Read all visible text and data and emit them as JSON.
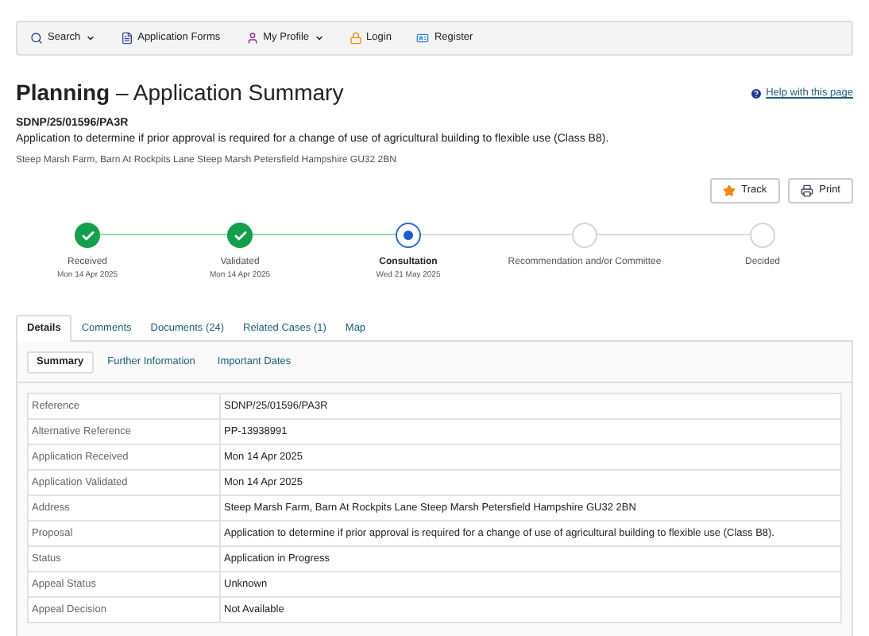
{
  "nav": [
    {
      "label": "Search",
      "dropdown": true
    },
    {
      "label": "Application Forms",
      "dropdown": false
    },
    {
      "label": "My Profile",
      "dropdown": true
    },
    {
      "label": "Login",
      "dropdown": false
    },
    {
      "label": "Register",
      "dropdown": false
    }
  ],
  "title": {
    "bold": "Planning",
    "rest": "– Application Summary"
  },
  "help_link": "Help with this page",
  "reference": "SDNP/25/01596/PA3R",
  "description": "Application to determine if prior approval is required for a change of use of agricultural building to flexible use (Class B8).",
  "address": "Steep Marsh Farm, Barn At Rockpits Lane Steep Marsh Petersfield Hampshire GU32 2BN",
  "actions": [
    {
      "label": "Track"
    },
    {
      "label": "Print"
    }
  ],
  "steps": [
    {
      "label": "Received",
      "date": "Mon 14 Apr 2025",
      "kind": "done"
    },
    {
      "label": "Validated",
      "date": "Mon 14 Apr 2025",
      "kind": "done"
    },
    {
      "label": "Consultation",
      "date": "Wed 21 May 2025",
      "kind": "current"
    },
    {
      "label": "Recommendation and/or Committee",
      "kind": "pending"
    },
    {
      "label": "Decided",
      "kind": "pending"
    }
  ],
  "tabs": [
    {
      "label": "Details",
      "selected": true
    },
    {
      "label": "Comments",
      "selected": false
    },
    {
      "label": "Documents (24)",
      "selected": false
    },
    {
      "label": "Related Cases (1)",
      "selected": false
    },
    {
      "label": "Map",
      "selected": false
    }
  ],
  "subtabs": [
    {
      "label": "Summary",
      "selected": true
    },
    {
      "label": "Further Information",
      "selected": false
    },
    {
      "label": "Important Dates",
      "selected": false
    }
  ],
  "table": {
    "rows": [
      {
        "label": "Reference",
        "value": "SDNP/25/01596/PA3R"
      },
      {
        "label": "Alternative Reference",
        "value": "PP-13938991"
      },
      {
        "label": "Application Received",
        "value": "Mon 14 Apr 2025"
      },
      {
        "label": "Application Validated",
        "value": "Mon 14 Apr 2025"
      },
      {
        "label": "Address",
        "value": "Steep Marsh Farm, Barn At Rockpits Lane Steep Marsh Petersfield Hampshire GU32 2BN"
      },
      {
        "label": "Proposal",
        "value": "Application to determine if prior approval is required for a change of use of agricultural building to flexible use (Class B8)."
      },
      {
        "label": "Status",
        "value": "Application in Progress"
      },
      {
        "label": "Appeal Status",
        "value": "Unknown"
      },
      {
        "label": "Appeal Decision",
        "value": "Not Available"
      }
    ]
  }
}
